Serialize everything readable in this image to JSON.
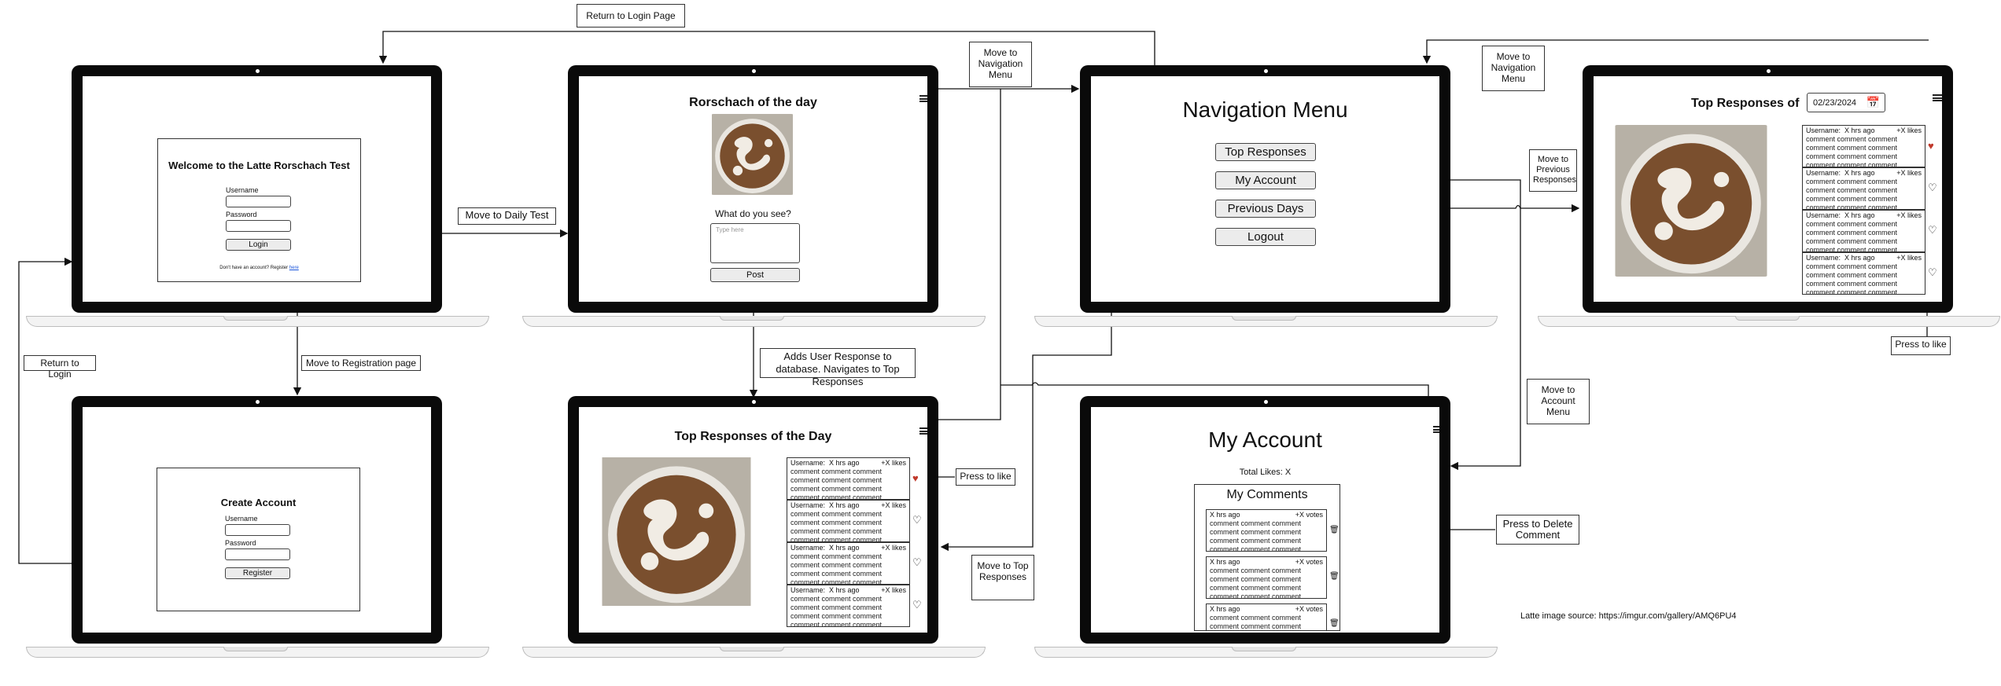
{
  "login": {
    "title": "Welcome to the Latte Rorschach Test",
    "username_label": "Username",
    "password_label": "Password",
    "login_button": "Login",
    "register_prompt": "Don't have an account?   Register ",
    "register_link": "here"
  },
  "register": {
    "title": "Create Account",
    "username_label": "Username",
    "password_label": "Password",
    "register_button": "Register"
  },
  "daily": {
    "title": "Rorschach of the day",
    "question": "What do you see?",
    "placeholder": "Type here",
    "post_button": "Post"
  },
  "top_day": {
    "title": "Top Responses of the Day"
  },
  "nav": {
    "title": "Navigation Menu",
    "items": [
      "Top Responses",
      "My Account",
      "Previous Days",
      "Logout"
    ]
  },
  "previous": {
    "title": "Top Responses of",
    "date": "02/23/2024"
  },
  "account": {
    "title": "My Account",
    "total_likes": "Total Likes: X",
    "comments_title": "My Comments"
  },
  "response_card": {
    "username": "Username:",
    "time": "X hrs ago",
    "likes": "+X likes",
    "body": "comment comment comment comment comment comment comment comment comment comment comment comment"
  },
  "comment_card": {
    "time": "X hrs ago",
    "votes": "+X votes",
    "body": "comment comment comment comment comment comment comment comment comment comment comment comment"
  },
  "notes": {
    "return_login_page": "Return to Login Page",
    "move_daily": "Move to Daily Test",
    "return_login": "Return to Login",
    "move_registration": "Move to Registration page",
    "move_nav_1": "Move to Navigation Menu",
    "move_nav_2": "Move to Navigation Menu",
    "adds_response": "Adds User Response to database. Navigates to Top Responses",
    "press_like_1": "Press to like",
    "move_top": "Move to Top Responses",
    "move_previous": "Move to Previous Responses",
    "press_like_2": "Press to like",
    "move_account": "Move to Account Menu",
    "press_delete": "Press to Delete Comment"
  },
  "source_note": "Latte image source: https://imgur.com/gallery/AMQ6PU4",
  "colors": {
    "heart_liked": "#c0392b",
    "screen": "#0a0a0a"
  }
}
